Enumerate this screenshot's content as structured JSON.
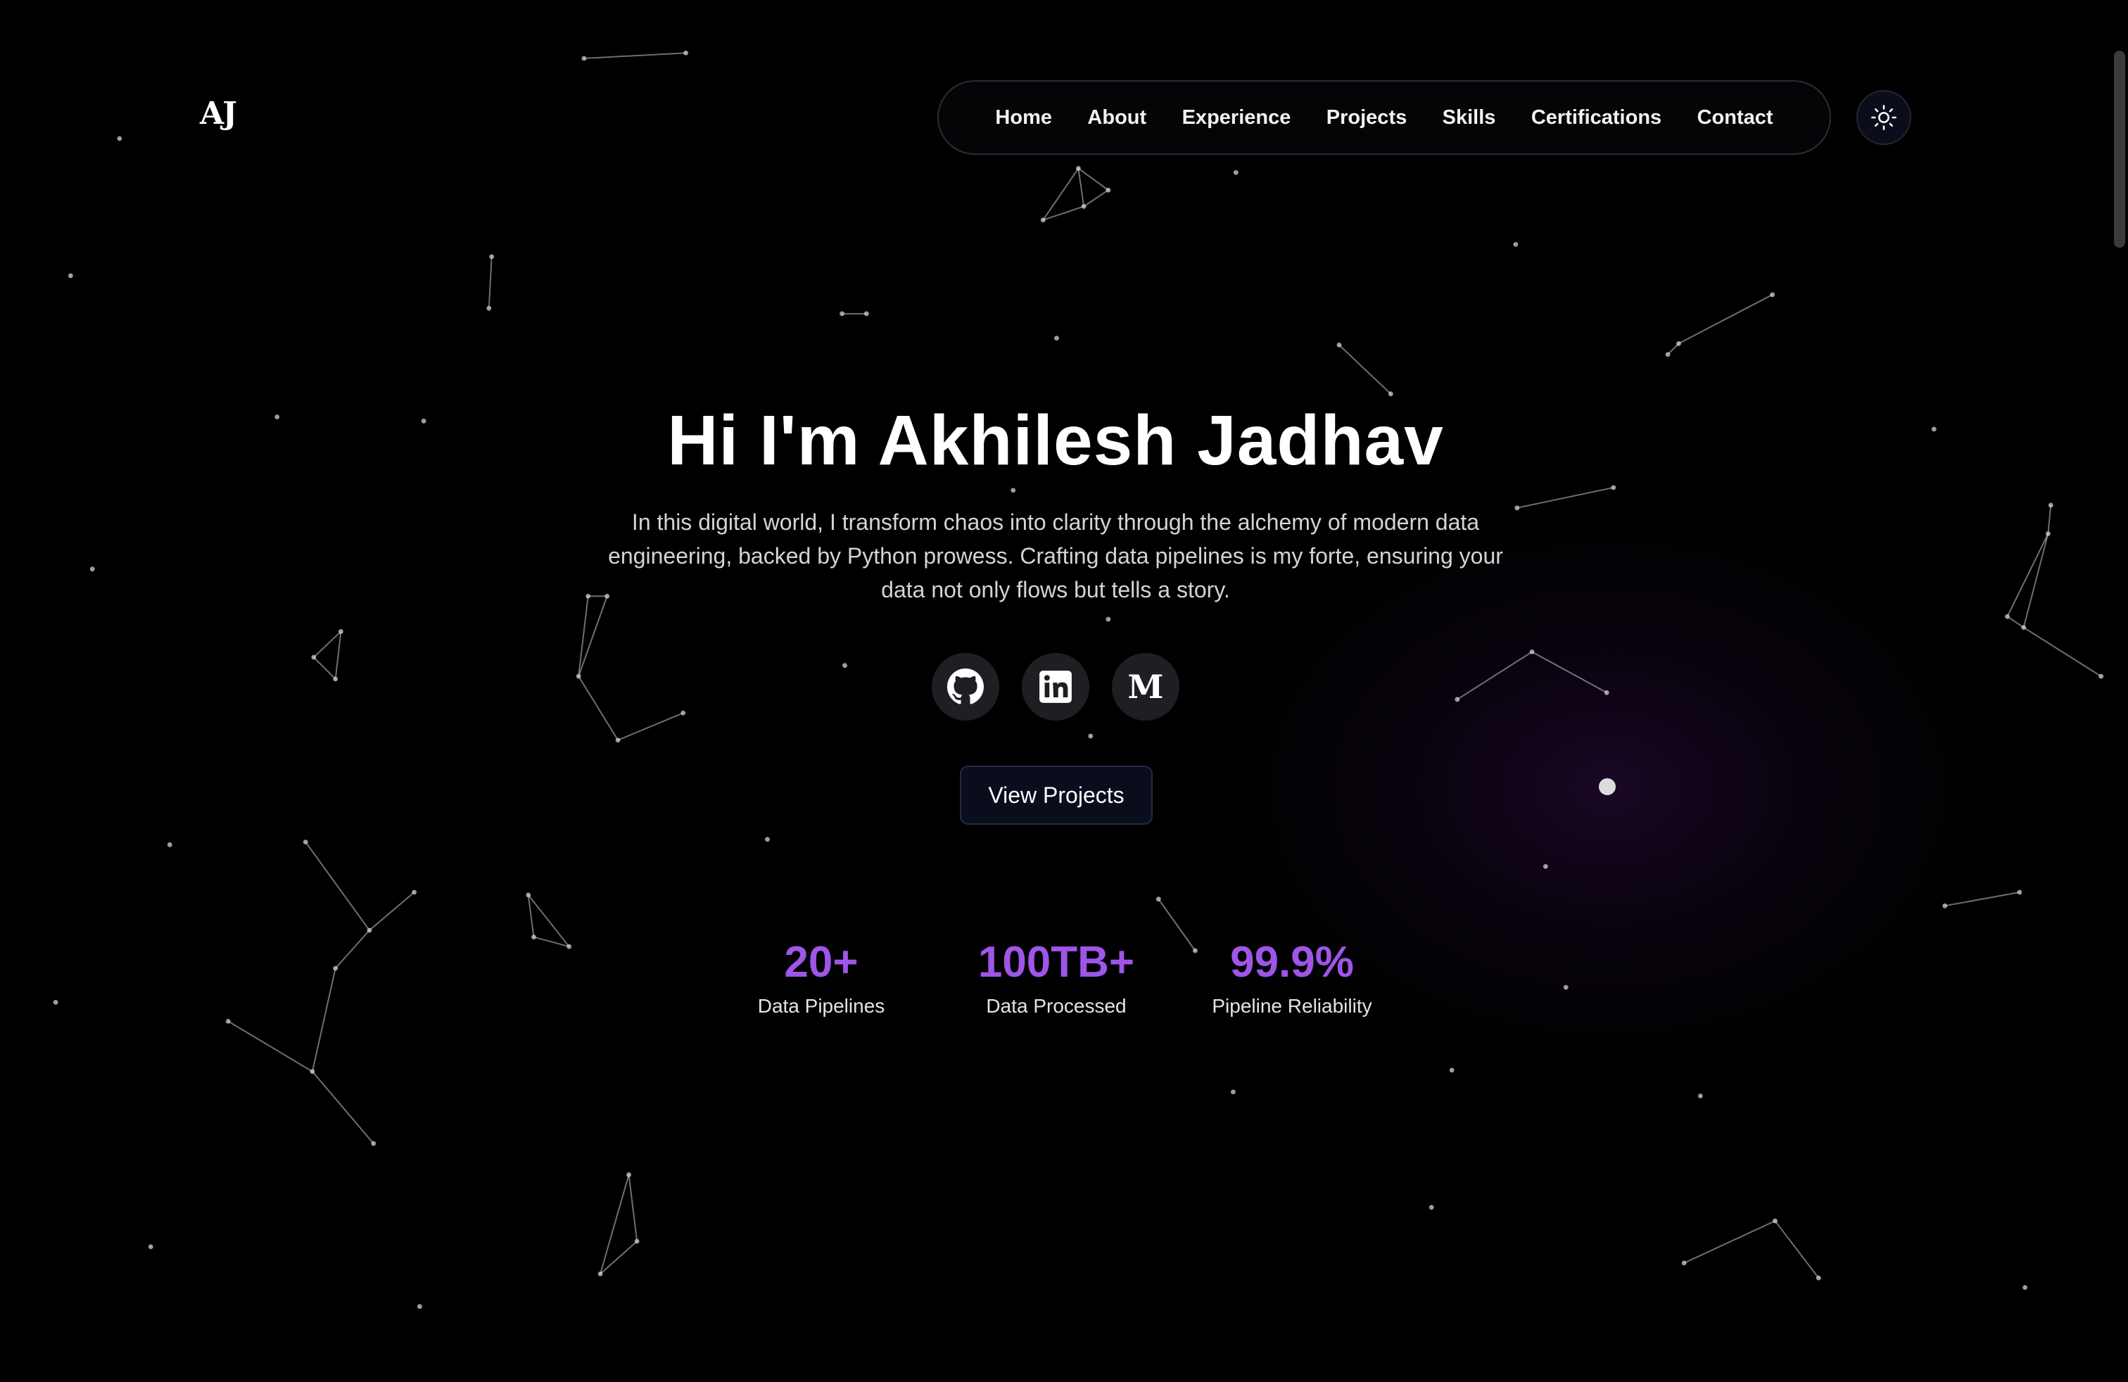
{
  "header": {
    "logo_text": "AJ",
    "nav_items": [
      {
        "label": "Home"
      },
      {
        "label": "About"
      },
      {
        "label": "Experience"
      },
      {
        "label": "Projects"
      },
      {
        "label": "Skills"
      },
      {
        "label": "Certifications"
      },
      {
        "label": "Contact"
      }
    ],
    "theme_toggle_icon": "sun-icon"
  },
  "hero": {
    "title": "Hi I'm Akhilesh Jadhav",
    "description": "In this digital world, I transform chaos into clarity through the alchemy of modern data engineering, backed by Python prowess. Crafting data pipelines is my forte, ensuring your data not only flows but tells a story.",
    "socials": [
      {
        "name": "github",
        "icon": "github-icon"
      },
      {
        "name": "linkedin",
        "icon": "linkedin-icon"
      },
      {
        "name": "medium",
        "icon": "medium-icon",
        "glyph": "M"
      }
    ],
    "cta_label": "View Projects"
  },
  "stats": [
    {
      "value": "20+",
      "label": "Data Pipelines"
    },
    {
      "value": "100TB+",
      "label": "Data Processed"
    },
    {
      "value": "99.9%",
      "label": "Pipeline Reliability"
    }
  ],
  "colors": {
    "background": "#000000",
    "accent": "#9f55e8",
    "nav_border": "#2a2d38",
    "button_bg": "#0a0d1c"
  }
}
